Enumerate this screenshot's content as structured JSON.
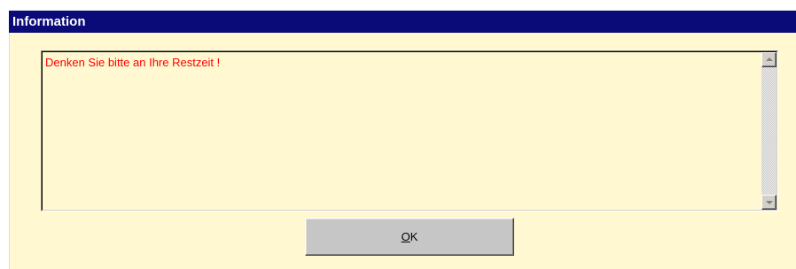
{
  "window": {
    "title": "Information"
  },
  "memo": {
    "text": "Denken Sie bitte an Ihre Restzeit !",
    "text_color": "#ff0000",
    "background_color": "#fff8d0"
  },
  "scrollbar": {
    "up_icon": "arrow-up-icon",
    "down_icon": "arrow-down-icon"
  },
  "buttons": {
    "ok": {
      "mnemonic": "O",
      "rest": "K"
    }
  },
  "colors": {
    "titlebar": "#0a0a78",
    "dialog_background": "#fff8d0",
    "button_face": "#c6c6c6"
  }
}
